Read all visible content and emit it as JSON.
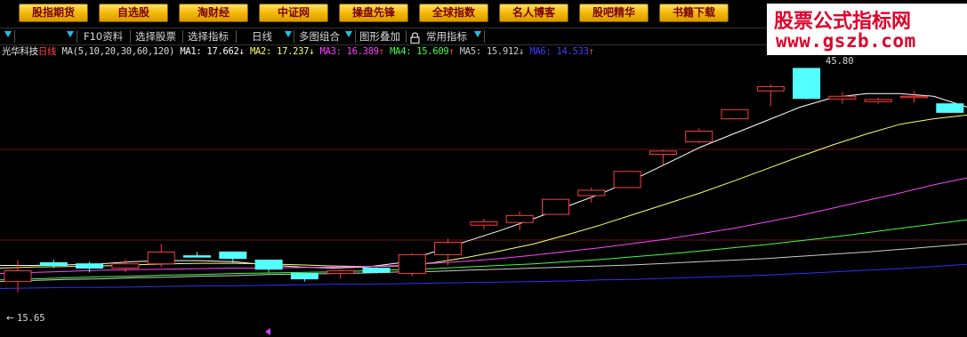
{
  "top_buttons": [
    "股指期货",
    "自选股",
    "淘财经",
    "中证网",
    "操盘先锋",
    "全球指数",
    "名人博客",
    "股吧精华",
    "书籍下载"
  ],
  "watermark": {
    "line1": "股票公式指标网",
    "line2": "www.gszb.com"
  },
  "toolbar": {
    "items": [
      "F10资料",
      "选择股票",
      "选择指标",
      "日线",
      "多图组合",
      "图形叠加",
      "常用指标"
    ],
    "lock_icon": "lock-icon"
  },
  "stock": {
    "name": "光华科技",
    "period": "日线"
  },
  "ma_legend": {
    "params": "MA(5,10,20,30,60,120)",
    "ma1": "MA1: 17.662",
    "ma2": "MA2: 17.237",
    "ma3": "MA3: 16.389",
    "ma4": "MA4: 15.609",
    "ma5": "MA5: 15.912",
    "ma6": "MA6: 14.533",
    "arrows": [
      "↓",
      "↓",
      "↑",
      "↑",
      "↓",
      "↑"
    ]
  },
  "price_labels": {
    "high": "45.80",
    "low": "15.65"
  },
  "colors": {
    "up": "#ff3c3c",
    "down": "#54ffff",
    "ma1": "#ffffff",
    "ma2": "#ffff66",
    "ma3": "#ff44ff",
    "ma4": "#44ff44",
    "ma5": "#cccccc",
    "ma6": "#2f2fff",
    "button": "#f2b600",
    "watermark": "#e0002a"
  },
  "chart_data": {
    "type": "candlestick",
    "ylim": [
      14.5,
      19.6
    ],
    "candles": [
      {
        "o": 15.65,
        "h": 15.85,
        "l": 15.25,
        "c": 15.45,
        "up": true
      },
      {
        "o": 15.8,
        "h": 15.86,
        "l": 15.7,
        "c": 15.75,
        "up": false
      },
      {
        "o": 15.78,
        "h": 15.82,
        "l": 15.62,
        "c": 15.7,
        "up": false
      },
      {
        "o": 15.7,
        "h": 15.86,
        "l": 15.62,
        "c": 15.78,
        "up": true
      },
      {
        "o": 15.78,
        "h": 16.15,
        "l": 15.72,
        "c": 16.0,
        "up": true
      },
      {
        "o": 15.93,
        "h": 16.0,
        "l": 15.9,
        "c": 15.93,
        "up": false
      },
      {
        "o": 16.0,
        "h": 16.0,
        "l": 15.8,
        "c": 15.88,
        "up": false
      },
      {
        "o": 15.85,
        "h": 15.85,
        "l": 15.62,
        "c": 15.68,
        "up": false
      },
      {
        "o": 15.6,
        "h": 15.6,
        "l": 15.45,
        "c": 15.5,
        "up": false
      },
      {
        "o": 15.6,
        "h": 15.68,
        "l": 15.5,
        "c": 15.65,
        "up": true
      },
      {
        "o": 15.7,
        "h": 15.72,
        "l": 15.6,
        "c": 15.62,
        "up": false
      },
      {
        "o": 15.6,
        "h": 15.98,
        "l": 15.55,
        "c": 15.95,
        "up": true
      },
      {
        "o": 15.95,
        "h": 16.25,
        "l": 15.75,
        "c": 16.18,
        "up": true
      },
      {
        "o": 16.5,
        "h": 16.62,
        "l": 16.42,
        "c": 16.56,
        "up": true
      },
      {
        "o": 16.55,
        "h": 16.76,
        "l": 16.4,
        "c": 16.68,
        "up": true
      },
      {
        "o": 16.7,
        "h": 16.98,
        "l": 16.7,
        "c": 16.98,
        "up": true
      },
      {
        "o": 17.05,
        "h": 17.2,
        "l": 16.92,
        "c": 17.15,
        "up": true
      },
      {
        "o": 17.2,
        "h": 17.5,
        "l": 17.2,
        "c": 17.5,
        "up": true
      },
      {
        "o": 17.82,
        "h": 17.9,
        "l": 17.62,
        "c": 17.88,
        "up": true
      },
      {
        "o": 18.05,
        "h": 18.3,
        "l": 18.03,
        "c": 18.25,
        "up": true
      },
      {
        "o": 18.48,
        "h": 18.65,
        "l": 18.48,
        "c": 18.65,
        "up": true
      },
      {
        "o": 19.0,
        "h": 19.12,
        "l": 18.72,
        "c": 19.08,
        "up": true
      },
      {
        "o": 19.42,
        "h": 19.42,
        "l": 18.84,
        "c": 18.86,
        "up": false
      },
      {
        "o": 18.9,
        "h": 18.98,
        "l": 18.76,
        "c": 18.85,
        "up": true
      },
      {
        "o": 18.8,
        "h": 18.87,
        "l": 18.76,
        "c": 18.84,
        "up": true
      },
      {
        "o": 18.88,
        "h": 19.0,
        "l": 18.78,
        "c": 18.9,
        "up": true
      },
      {
        "o": 18.76,
        "h": 18.76,
        "l": 18.6,
        "c": 18.6,
        "up": false
      }
    ],
    "series": [
      {
        "values": [
          15.75,
          15.75,
          15.76,
          15.78,
          15.82,
          15.84,
          15.84,
          15.82,
          15.76,
          15.72,
          15.7,
          15.72,
          15.8,
          16.0,
          16.2,
          16.4,
          16.62,
          16.85,
          17.08,
          17.35,
          17.65,
          17.95,
          18.2,
          18.45,
          18.7,
          18.88,
          18.95,
          18.95,
          18.9,
          18.7
        ]
      },
      {
        "values": [
          15.7,
          15.72,
          15.73,
          15.74,
          15.76,
          15.78,
          15.79,
          15.79,
          15.78,
          15.76,
          15.74,
          15.73,
          15.74,
          15.8,
          15.9,
          16.02,
          16.15,
          16.32,
          16.5,
          16.7,
          16.9,
          17.1,
          17.32,
          17.55,
          17.78,
          18.0,
          18.2,
          18.38,
          18.48,
          18.55
        ]
      },
      {
        "values": [
          15.6,
          15.62,
          15.64,
          15.66,
          15.67,
          15.68,
          15.69,
          15.7,
          15.7,
          15.71,
          15.72,
          15.73,
          15.75,
          15.79,
          15.83,
          15.88,
          15.94,
          16.01,
          16.08,
          16.16,
          16.24,
          16.34,
          16.44,
          16.56,
          16.68,
          16.82,
          16.96,
          17.1,
          17.25,
          17.38
        ]
      },
      {
        "values": [
          15.48,
          15.5,
          15.52,
          15.54,
          15.55,
          15.57,
          15.58,
          15.6,
          15.61,
          15.62,
          15.63,
          15.65,
          15.67,
          15.69,
          15.72,
          15.75,
          15.78,
          15.82,
          15.86,
          15.91,
          15.96,
          16.02,
          16.08,
          16.14,
          16.21,
          16.28,
          16.36,
          16.44,
          16.52,
          16.6
        ]
      },
      {
        "values": [
          15.45,
          15.47,
          15.49,
          15.5,
          15.52,
          15.53,
          15.55,
          15.56,
          15.58,
          15.59,
          15.6,
          15.61,
          15.63,
          15.64,
          15.66,
          15.68,
          15.7,
          15.72,
          15.74,
          15.76,
          15.79,
          15.82,
          15.85,
          15.88,
          15.92,
          15.96,
          16.0,
          16.05,
          16.1,
          16.15
        ]
      },
      {
        "values": [
          15.32,
          15.33,
          15.34,
          15.34,
          15.35,
          15.36,
          15.37,
          15.37,
          15.38,
          15.39,
          15.4,
          15.4,
          15.41,
          15.42,
          15.43,
          15.44,
          15.45,
          15.46,
          15.48,
          15.49,
          15.51,
          15.53,
          15.55,
          15.57,
          15.6,
          15.63,
          15.66,
          15.69,
          15.73,
          15.77
        ]
      }
    ]
  }
}
